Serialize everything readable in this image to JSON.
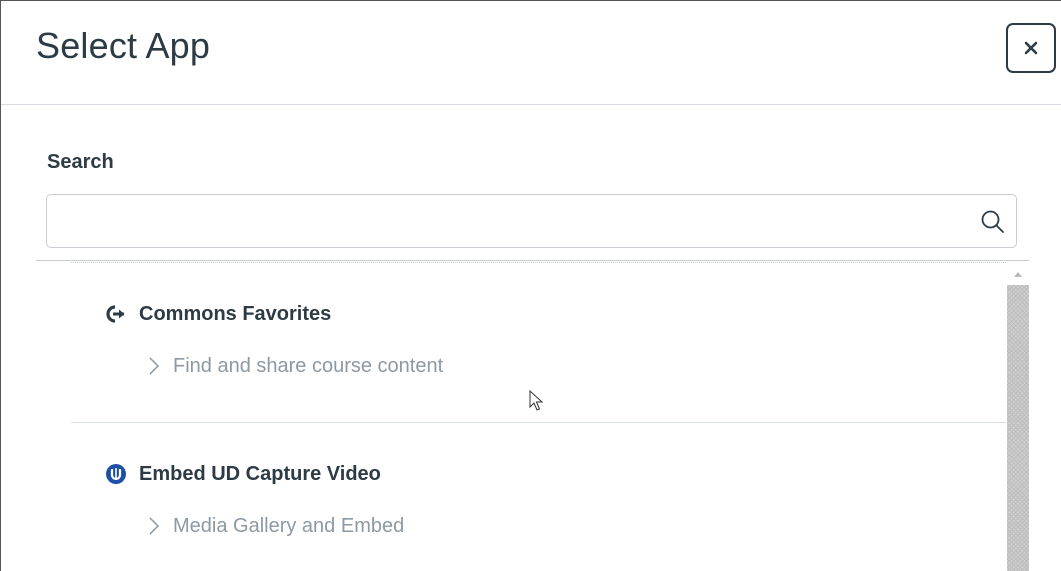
{
  "dialog": {
    "title": "Select App",
    "close_label": "×"
  },
  "search": {
    "label": "Search",
    "value": "",
    "placeholder": ""
  },
  "apps": [
    {
      "name": "Commons Favorites",
      "icon": "commons-icon",
      "description": "Find and share course content"
    },
    {
      "name": "Embed UD Capture Video",
      "icon": "ud-capture-icon",
      "description": "Media Gallery and Embed"
    }
  ],
  "colors": {
    "text_primary": "#2d3b45",
    "text_secondary": "#8c99a4",
    "border": "#c7cdd1",
    "ud_blue": "#1f4fa8"
  }
}
